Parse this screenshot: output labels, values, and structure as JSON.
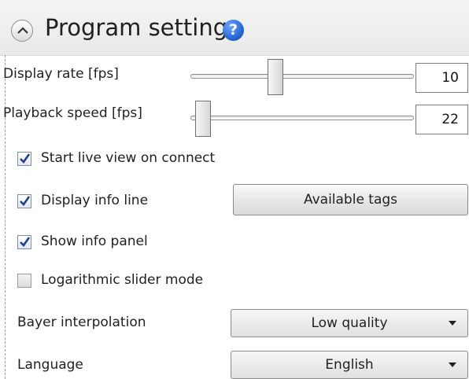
{
  "header": {
    "title": "Program settings",
    "help_icon": "help-icon",
    "collapse_icon": "chevron-up-icon"
  },
  "display_rate": {
    "label": "Display rate [fps]",
    "value": "10",
    "slider_level_percent": 40
  },
  "playback_speed": {
    "label": "Playback speed [fps]",
    "value": "22",
    "slider_level_percent": 0
  },
  "options": {
    "start_live_view": {
      "label": "Start live view on connect",
      "checked": true
    },
    "display_info_line": {
      "label": "Display info line",
      "checked": true
    },
    "show_info_panel": {
      "label": "Show info panel",
      "checked": true
    },
    "logarithmic_slider": {
      "label": "Logarithmic slider mode",
      "checked": false
    }
  },
  "available_tags_button": {
    "label": "Available tags"
  },
  "bayer_interpolation": {
    "label": "Bayer interpolation",
    "selected": "Low quality"
  },
  "language": {
    "label": "Language",
    "selected": "English"
  },
  "colors": {
    "help_blue": "#1e5fcf",
    "checkmark": "#1c3f94"
  }
}
